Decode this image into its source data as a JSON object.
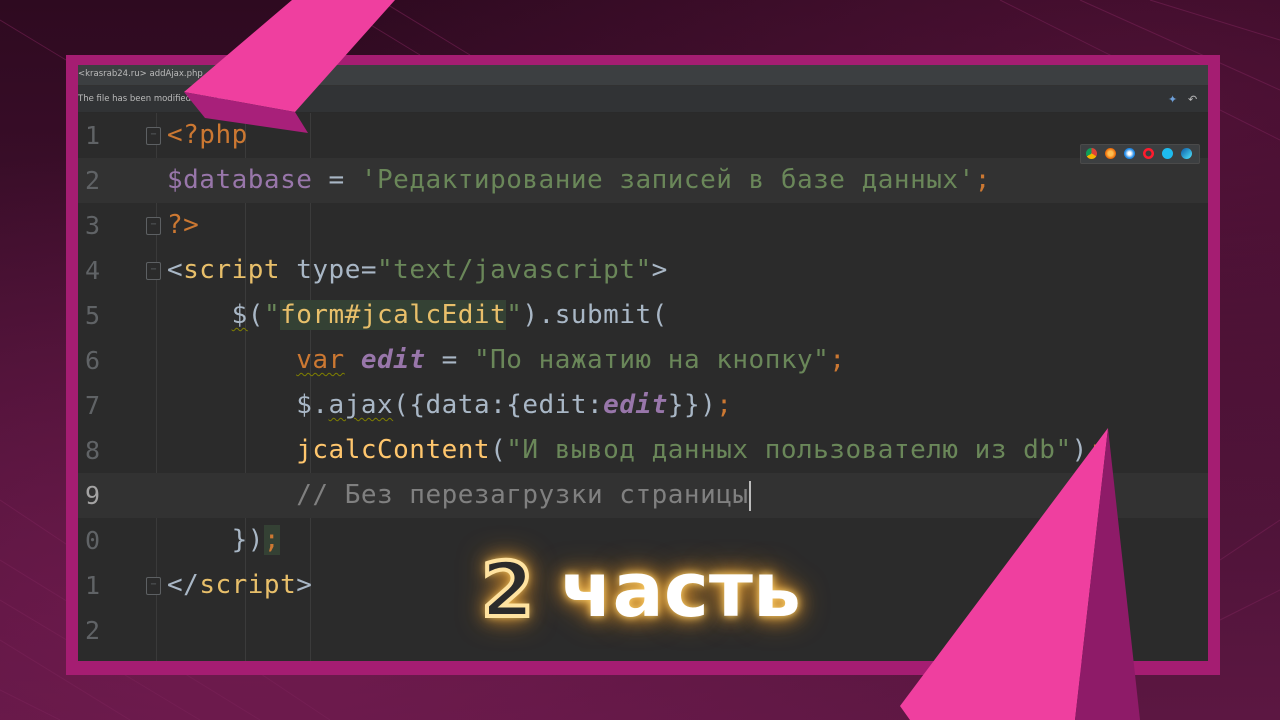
{
  "window": {
    "breadcrumb": "<krasrab24.ru> addAjax.php",
    "notice": "The file has been modified. Upload"
  },
  "icons": [
    "bolt-icon",
    "undo-icon",
    "chrome-icon",
    "firefox-icon",
    "safari-icon",
    "opera-icon",
    "ie-icon",
    "edge-icon"
  ],
  "editor": {
    "line_numbers": [
      "1",
      "2",
      "3",
      "4",
      "5",
      "6",
      "7",
      "8",
      "9",
      "0",
      "1",
      "2"
    ],
    "current_line": "9",
    "lines": [
      {
        "segments": [
          [
            "kw",
            "<?php"
          ]
        ]
      },
      {
        "segments": [
          [
            "var",
            "$database"
          ],
          [
            "plain",
            " = "
          ],
          [
            "str",
            "'Редактирование записей в базе данных'"
          ],
          [
            "kw",
            ";"
          ]
        ]
      },
      {
        "segments": [
          [
            "kw",
            "?>"
          ]
        ]
      },
      {
        "segments": [
          [
            "plain",
            "<"
          ],
          [
            "tag",
            "script"
          ],
          [
            "plain",
            " "
          ],
          [
            "plain",
            "type"
          ],
          [
            "plain",
            "="
          ],
          [
            "str",
            "\"text/javascript\""
          ],
          [
            "plain",
            ">"
          ]
        ]
      },
      {
        "segments": [
          [
            "plain",
            "    "
          ],
          [
            "squig",
            "$"
          ],
          [
            "plain",
            "("
          ],
          [
            "str",
            "\""
          ],
          [
            "strmatch",
            "form#jcalcEdit"
          ],
          [
            "str",
            "\""
          ],
          [
            "plain",
            ").submit("
          ]
        ]
      },
      {
        "segments": [
          [
            "plain",
            "        "
          ],
          [
            "kwsquig",
            "var"
          ],
          [
            "plain",
            " "
          ],
          [
            "ivar",
            "edit"
          ],
          [
            "plain",
            " = "
          ],
          [
            "str",
            "\"По нажатию на кнопку\""
          ],
          [
            "kw",
            ";"
          ]
        ]
      },
      {
        "segments": [
          [
            "plain",
            "        $."
          ],
          [
            "plainsquig",
            "ajax"
          ],
          [
            "plain",
            "({data:{edit:"
          ],
          [
            "ivar",
            "edit"
          ],
          [
            "plain",
            "}})"
          ],
          [
            "kw",
            ";"
          ]
        ]
      },
      {
        "segments": [
          [
            "plain",
            "        "
          ],
          [
            "fn",
            "jcalcContent"
          ],
          [
            "plain",
            "("
          ],
          [
            "str",
            "\"И вывод данных пользователю из db\""
          ],
          [
            "plain",
            ")"
          ],
          [
            "kw",
            ";"
          ]
        ]
      },
      {
        "segments": [
          [
            "plain",
            "        "
          ],
          [
            "cmt",
            "// Без перезагрузки страницы"
          ],
          [
            "caret",
            ""
          ]
        ]
      },
      {
        "segments": [
          [
            "plain",
            "    })"
          ],
          [
            "kwmatch",
            ";"
          ]
        ]
      },
      {
        "segments": [
          [
            "plain",
            "</"
          ],
          [
            "tag",
            "script"
          ],
          [
            "plain",
            ">"
          ]
        ]
      },
      {
        "segments": []
      }
    ]
  },
  "overlay": {
    "number": "2",
    "label": "часть"
  },
  "colors": {
    "frame": "#a51d72",
    "accent_pink": "#f03ea0",
    "glow": "#f0a73a"
  }
}
